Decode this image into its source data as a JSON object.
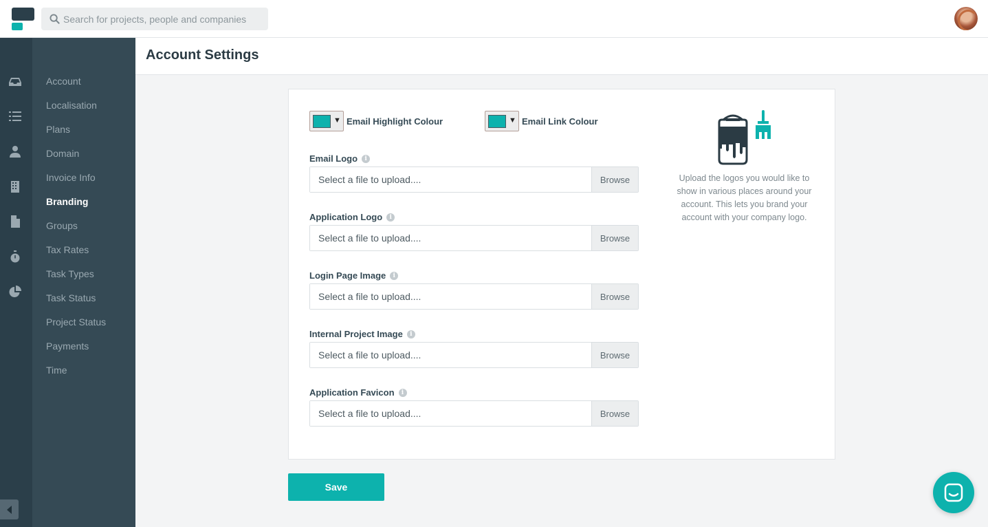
{
  "header": {
    "search_placeholder": "Search for projects, people and companies"
  },
  "rail": {
    "icons": [
      "inbox-icon",
      "list-icon",
      "person-icon",
      "building-icon",
      "document-icon",
      "stopwatch-icon",
      "pie-chart-icon"
    ]
  },
  "submenu": {
    "items": [
      {
        "label": "Account",
        "active": false
      },
      {
        "label": "Localisation",
        "active": false
      },
      {
        "label": "Plans",
        "active": false
      },
      {
        "label": "Domain",
        "active": false
      },
      {
        "label": "Invoice Info",
        "active": false
      },
      {
        "label": "Branding",
        "active": true
      },
      {
        "label": "Groups",
        "active": false
      },
      {
        "label": "Tax Rates",
        "active": false
      },
      {
        "label": "Task Types",
        "active": false
      },
      {
        "label": "Task Status",
        "active": false
      },
      {
        "label": "Project Status",
        "active": false
      },
      {
        "label": "Payments",
        "active": false
      },
      {
        "label": "Time",
        "active": false
      }
    ]
  },
  "page": {
    "title": "Account Settings"
  },
  "branding": {
    "email_highlight_label": "Email Highlight Colour",
    "email_highlight_color": "#0db2ad",
    "email_link_label": "Email Link Colour",
    "email_link_color": "#0db2ad",
    "fields": [
      {
        "label": "Email Logo",
        "placeholder": "Select a file to upload....",
        "browse": "Browse"
      },
      {
        "label": "Application Logo",
        "placeholder": "Select a file to upload....",
        "browse": "Browse"
      },
      {
        "label": "Login Page Image",
        "placeholder": "Select a file to upload....",
        "browse": "Browse"
      },
      {
        "label": "Internal Project Image",
        "placeholder": "Select a file to upload....",
        "browse": "Browse"
      },
      {
        "label": "Application Favicon",
        "placeholder": "Select a file to upload....",
        "browse": "Browse"
      }
    ],
    "help_text": "Upload the logos you would like to show in various places around your account. This lets you brand your account with your company logo."
  },
  "actions": {
    "save_label": "Save"
  },
  "colors": {
    "accent": "#0db2ad",
    "dark_nav": "#2b3f4a",
    "submenu_bg": "#354a55"
  }
}
